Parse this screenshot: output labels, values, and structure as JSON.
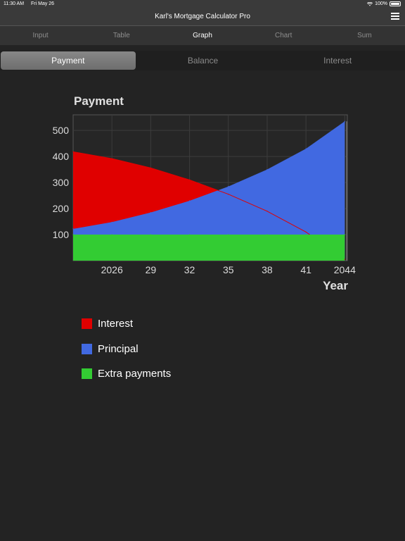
{
  "status": {
    "time": "11:30 AM",
    "date": "Fri May 26",
    "battery": "100%"
  },
  "app": {
    "title": "Karl's Mortgage Calculator Pro"
  },
  "tabs": [
    {
      "label": "Input",
      "active": false
    },
    {
      "label": "Table",
      "active": false
    },
    {
      "label": "Graph",
      "active": true
    },
    {
      "label": "Chart",
      "active": false
    },
    {
      "label": "Sum",
      "active": false
    }
  ],
  "segments": [
    {
      "label": "Payment",
      "active": true
    },
    {
      "label": "Balance",
      "active": false
    },
    {
      "label": "Interest",
      "active": false
    }
  ],
  "colors": {
    "interest": "#e00000",
    "principal": "#4169e1",
    "extra": "#33cc33"
  },
  "chart_data": {
    "type": "area",
    "title": "Payment",
    "xlabel": "Year",
    "ylabel": "",
    "xlim": [
      2023,
      2044.2
    ],
    "ylim": [
      0,
      560
    ],
    "x_ticks": [
      2026,
      2029,
      2032,
      2035,
      2038,
      2041,
      2044
    ],
    "x_tick_labels": [
      "2026",
      "29",
      "32",
      "35",
      "38",
      "41",
      "2044"
    ],
    "y_ticks": [
      100,
      200,
      300,
      400,
      500
    ],
    "grid": true,
    "x": [
      2023,
      2026,
      2029,
      2032,
      2035,
      2038,
      2041,
      2044
    ],
    "series": [
      {
        "name": "Interest",
        "values": [
          418,
          392,
          356,
          310,
          255,
          190,
          110,
          5
        ]
      },
      {
        "name": "Principal",
        "values": [
          122,
          148,
          185,
          230,
          285,
          350,
          430,
          535
        ]
      },
      {
        "name": "Extra payments",
        "values": [
          100,
          100,
          100,
          100,
          100,
          100,
          100,
          100
        ]
      }
    ]
  }
}
